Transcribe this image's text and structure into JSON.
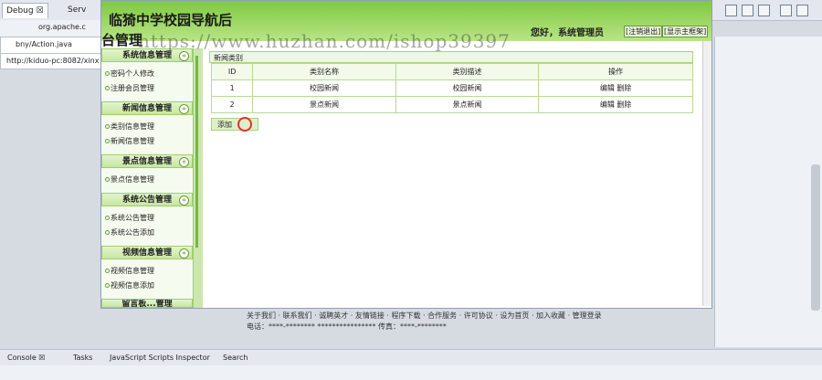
{
  "ide": {
    "tabs": [
      "Debug ☒",
      "Serv"
    ],
    "tree_item": "org.apache.c",
    "file_tab": "bny/Action.java",
    "url": "http://kiduo-pc:8082/xinx",
    "console_tabs": [
      "Console ☒",
      "Tasks",
      "JavaScript Scripts Inspector",
      "Search"
    ]
  },
  "site": {
    "title": "临猗中学校园导航后",
    "title2": "台管理",
    "watermark": "https://www.huzhan.com/ishop39397",
    "welcome": "您好，系统管理员",
    "logout": "[注销退出]",
    "home": "[显示主框架]"
  },
  "sidebar": {
    "groups": [
      {
        "title": "系统信息管理",
        "items": [
          "密码个人修改",
          "注册会员管理"
        ]
      },
      {
        "title": "新闻信息管理",
        "items": [
          "类别信息管理",
          "新闻信息管理"
        ]
      },
      {
        "title": "景点信息管理",
        "items": [
          "景点信息管理"
        ]
      },
      {
        "title": "系统公告管理",
        "items": [
          "系统公告管理",
          "系统公告添加"
        ]
      },
      {
        "title": "视频信息管理",
        "items": [
          "视频信息管理",
          "视频信息添加"
        ]
      },
      {
        "title": "留言板...管理",
        "items": []
      }
    ],
    "toggle": "«"
  },
  "content": {
    "panel_title": "新闻类别",
    "columns": [
      "ID",
      "类别名称",
      "类别描述",
      "操作"
    ],
    "rows": [
      {
        "id": "1",
        "name": "校园新闻",
        "desc": "校园新闻",
        "ops": "编辑 删除"
      },
      {
        "id": "2",
        "name": "景点新闻",
        "desc": "景点新闻",
        "ops": "编辑 删除"
      }
    ],
    "add_label": "添加"
  },
  "footer": {
    "links": "关于我们 · 联系我们 · 诚聘英才 · 友情链接 · 程序下载 · 合作服务 · 许可协议 · 设为首页 · 加入收藏 · 管理登录",
    "contact": "电话：****-******** **************** 传真：****-********"
  },
  "colors": {
    "accent": "#7fc93f",
    "border": "#a9d27f"
  }
}
